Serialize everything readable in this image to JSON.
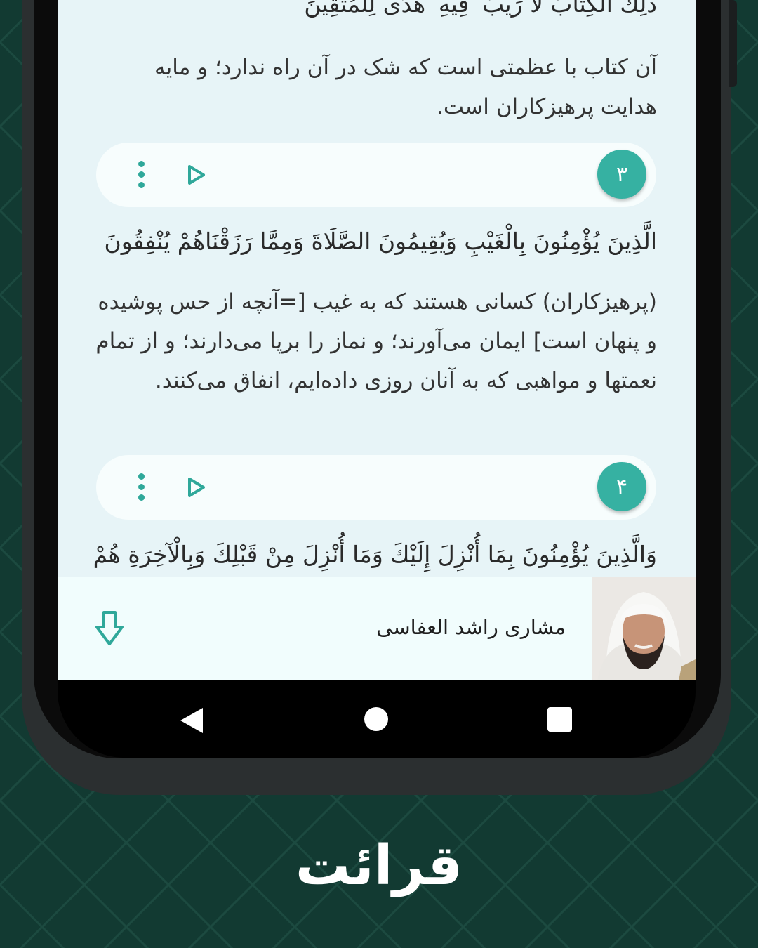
{
  "theme": {
    "background": "#123a32",
    "accent": "#36b1a2",
    "screen_bg": "#e7f4f7",
    "player_bg": "#f1fdfd"
  },
  "verses": [
    {
      "arabic": "ذَٰلِكَ الْكِتَابُ لَا رَيْبَ ۛ فِيهِ ۛ هُدًى لِلْمُتَّقِينَ",
      "translation": "آن کتاب با عظمتی است که شک در آن راه ندارد؛ و مایه هدایت پرهیزکاران است."
    },
    {
      "number": "۳",
      "arabic": "الَّذِينَ يُؤْمِنُونَ بِالْغَيْبِ وَيُقِيمُونَ الصَّلَاةَ وَمِمَّا رَزَقْنَاهُمْ يُنْفِقُونَ",
      "translation": "(پرهیزکاران) کسانی هستند که به غیب [=آنچه از حس پوشیده و پنهان است] ایمان می‌آورند؛ و نماز را برپا می‌دارند؛ و از تمام نعمتها و مواهبی که به آنان روزی داده‌ایم، انفاق می‌کنند."
    },
    {
      "number": "۴",
      "arabic": "وَالَّذِينَ يُؤْمِنُونَ بِمَا أُنْزِلَ إِلَيْكَ وَمَا أُنْزِلَ مِنْ قَبْلِكَ وَبِالْآخِرَةِ هُمْ"
    }
  ],
  "player": {
    "reciter_name": "مشاری راشد العفاسی",
    "download_icon": "arrow-down-icon",
    "avatar": "reciter-photo"
  },
  "icons": {
    "more": "more-vertical-icon",
    "play": "play-outline-icon"
  },
  "caption": "قرائت"
}
